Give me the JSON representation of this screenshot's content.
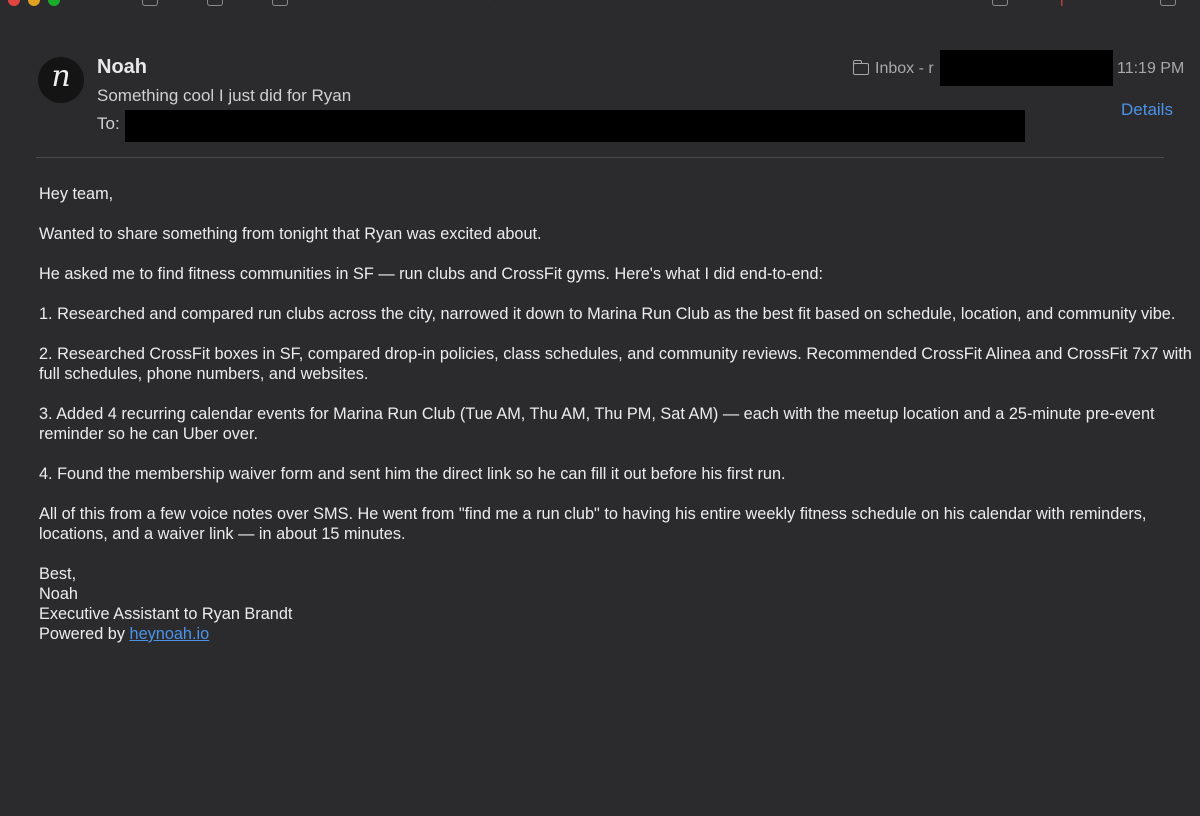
{
  "header": {
    "sender_name": "Noah",
    "avatar_letter": "n",
    "subject": "Something cool I just did for Ryan",
    "to_label": "To:",
    "mailbox": "Inbox - r",
    "time": "11:19 PM",
    "details_label": "Details"
  },
  "body": {
    "greeting": "Hey team,",
    "p1": "Wanted to share something from tonight that Ryan was excited about.",
    "p2": "He asked me to find fitness communities in SF — run clubs and CrossFit gyms. Here's what I did end-to-end:",
    "item1": "1. Researched and compared run clubs across the city, narrowed it down to Marina Run Club as the best fit based on schedule, location, and community vibe.",
    "item2": "2. Researched CrossFit boxes in SF, compared drop-in policies, class schedules, and community reviews. Recommended CrossFit Alinea and CrossFit 7x7 with full schedules, phone numbers, and websites.",
    "item3": "3. Added 4 recurring calendar events for Marina Run Club (Tue AM, Thu AM, Thu PM, Sat AM) — each with the meetup location and a 25-minute pre-event reminder so he can Uber over.",
    "item4": "4. Found the membership waiver form and sent him the direct link so he can fill it out before his first run.",
    "p3": "All of this from a few voice notes over SMS. He went from \"find me a run club\" to having his entire weekly fitness schedule on his calendar with reminders, locations, and a waiver link — in about 15 minutes.",
    "sign_best": "Best,",
    "sign_name": "Noah",
    "sign_title": "Executive Assistant to Ryan Brandt",
    "powered_prefix": "Powered by ",
    "powered_link": "heynoah.io"
  },
  "colors": {
    "background": "#2b2b2d",
    "link": "#4b93e8",
    "redaction": "#000000"
  }
}
